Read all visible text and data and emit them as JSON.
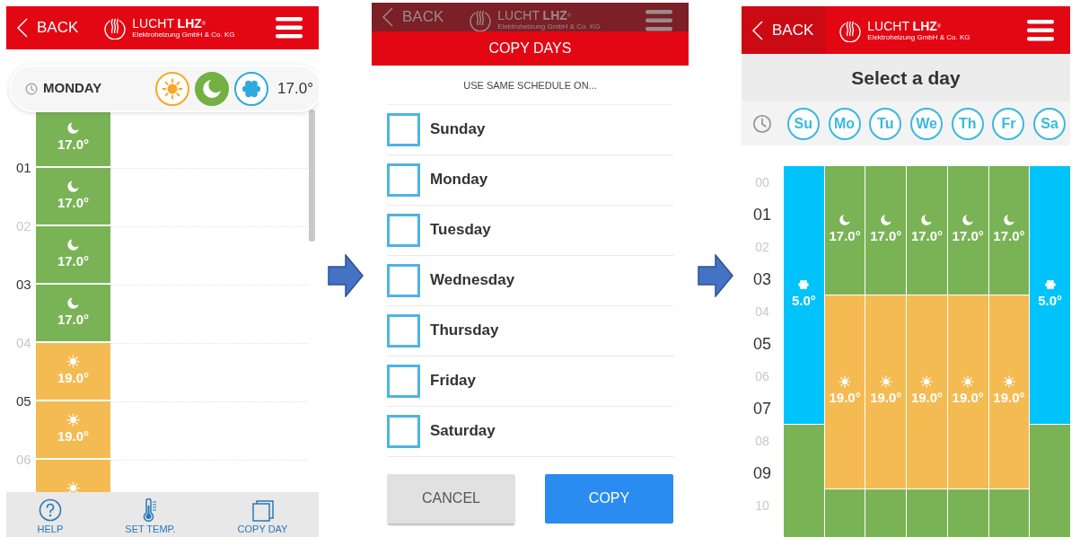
{
  "phones": [
    {
      "kind": "schedule",
      "header": {
        "back": "BACK",
        "brand": "LUCHT **LHZ**$^{®}$",
        "tagline": "Elektroheizung GmbH & Co. KG",
        "dimmed": false,
        "back_pressed": false
      },
      "day_bar": {
        "day": "MONDAY",
        "modes": [
          {
            "kind": "day",
            "selected": false
          },
          {
            "kind": "night",
            "selected": true
          },
          {
            "kind": "frost",
            "selected": false
          }
        ],
        "temperature": "17.0°"
      },
      "rows": [
        {
          "kind": "night",
          "temp": "17.0°"
        },
        {
          "hour": "01",
          "major": true,
          "kind": "night",
          "temp": "17.0°"
        },
        {
          "hour": "02",
          "major": false,
          "kind": "night",
          "temp": "17.0°"
        },
        {
          "hour": "03",
          "major": true,
          "kind": "night",
          "temp": "17.0°"
        },
        {
          "hour": "04",
          "major": false,
          "kind": "day",
          "temp": "19.0°"
        },
        {
          "hour": "05",
          "major": true,
          "kind": "day",
          "temp": "19.0°"
        },
        {
          "hour": "06",
          "major": false,
          "kind": "day"
        }
      ],
      "toolbar": [
        {
          "kind": "help",
          "label": "HELP"
        },
        {
          "kind": "thermometer",
          "label": "SET TEMP."
        },
        {
          "kind": "copy",
          "label": "COPY DAY"
        }
      ]
    },
    {
      "kind": "copy_days",
      "header": {
        "back": "BACK",
        "brand": "LUCHT **LHZ**$^{®}$",
        "tagline": "Elektroheizung GmbH & Co. KG",
        "dimmed": true,
        "back_pressed": false
      },
      "title": "COPY DAYS",
      "prompt": "USE SAME SCHEDULE ON...",
      "days": [
        {
          "label": "Sunday",
          "checked": false
        },
        {
          "label": "Monday",
          "checked": false
        },
        {
          "label": "Tuesday",
          "checked": false
        },
        {
          "label": "Wednesday",
          "checked": false
        },
        {
          "label": "Thursday",
          "checked": false
        },
        {
          "label": "Friday",
          "checked": false
        },
        {
          "label": "Saturday",
          "checked": false
        }
      ],
      "buttons": [
        {
          "kind": "cancel",
          "label": "CANCEL"
        },
        {
          "kind": "primary",
          "label": "COPY"
        }
      ]
    },
    {
      "kind": "week",
      "header": {
        "back": "BACK",
        "brand": "LUCHT **LHZ**$^{®}$",
        "tagline": "Elektroheizung GmbH & Co. KG",
        "dimmed": false,
        "back_pressed": true
      },
      "title": "Select a day",
      "hours": [
        {
          "label": "00",
          "major": false
        },
        {
          "label": "01",
          "major": true
        },
        {
          "label": "02",
          "major": false
        },
        {
          "label": "03",
          "major": true
        },
        {
          "label": "04",
          "major": false
        },
        {
          "label": "05",
          "major": true
        },
        {
          "label": "06",
          "major": false
        },
        {
          "label": "07",
          "major": true
        },
        {
          "label": "08",
          "major": false
        },
        {
          "label": "09",
          "major": true
        },
        {
          "label": "10",
          "major": false
        }
      ],
      "days": [
        {
          "label": "Su",
          "slots": [
            {
              "kind": "frost",
              "temp": "5.0°"
            },
            {
              "kind": "frost"
            },
            {
              "kind": "frost"
            },
            {
              "kind": "frost"
            },
            {
              "kind": "frost"
            },
            {
              "kind": "frost"
            },
            {
              "kind": "frost"
            },
            {
              "kind": "frost"
            },
            {
              "kind": "night"
            },
            {
              "kind": "night"
            },
            {
              "kind": "night"
            },
            {
              "kind": "night"
            }
          ]
        },
        {
          "label": "Mo",
          "slots": [
            {
              "kind": "night",
              "temp": "17.0°"
            },
            {
              "kind": "night"
            },
            {
              "kind": "night"
            },
            {
              "kind": "night"
            },
            {
              "kind": "day",
              "temp": "19.0°"
            },
            {
              "kind": "day"
            },
            {
              "kind": "day"
            },
            {
              "kind": "day"
            },
            {
              "kind": "day"
            },
            {
              "kind": "day"
            },
            {
              "kind": "night"
            },
            {
              "kind": "night"
            }
          ]
        },
        {
          "label": "Tu",
          "slots": [
            {
              "kind": "night",
              "temp": "17.0°"
            },
            {
              "kind": "night"
            },
            {
              "kind": "night"
            },
            {
              "kind": "night"
            },
            {
              "kind": "day",
              "temp": "19.0°"
            },
            {
              "kind": "day"
            },
            {
              "kind": "day"
            },
            {
              "kind": "day"
            },
            {
              "kind": "day"
            },
            {
              "kind": "day"
            },
            {
              "kind": "night"
            },
            {
              "kind": "night"
            }
          ]
        },
        {
          "label": "We",
          "slots": [
            {
              "kind": "night",
              "temp": "17.0°"
            },
            {
              "kind": "night"
            },
            {
              "kind": "night"
            },
            {
              "kind": "night"
            },
            {
              "kind": "day",
              "temp": "19.0°"
            },
            {
              "kind": "day"
            },
            {
              "kind": "day"
            },
            {
              "kind": "day"
            },
            {
              "kind": "day"
            },
            {
              "kind": "day"
            },
            {
              "kind": "night"
            },
            {
              "kind": "night"
            }
          ]
        },
        {
          "label": "Th",
          "slots": [
            {
              "kind": "night",
              "temp": "17.0°"
            },
            {
              "kind": "night"
            },
            {
              "kind": "night"
            },
            {
              "kind": "night"
            },
            {
              "kind": "day",
              "temp": "19.0°"
            },
            {
              "kind": "day"
            },
            {
              "kind": "day"
            },
            {
              "kind": "day"
            },
            {
              "kind": "day"
            },
            {
              "kind": "day"
            },
            {
              "kind": "night"
            },
            {
              "kind": "night"
            }
          ]
        },
        {
          "label": "Fr",
          "slots": [
            {
              "kind": "night",
              "temp": "17.0°"
            },
            {
              "kind": "night"
            },
            {
              "kind": "night"
            },
            {
              "kind": "night"
            },
            {
              "kind": "day",
              "temp": "19.0°"
            },
            {
              "kind": "day"
            },
            {
              "kind": "day"
            },
            {
              "kind": "day"
            },
            {
              "kind": "day"
            },
            {
              "kind": "day"
            },
            {
              "kind": "night"
            },
            {
              "kind": "night"
            }
          ]
        },
        {
          "label": "Sa",
          "slots": [
            {
              "kind": "frost",
              "temp": "5.0°"
            },
            {
              "kind": "frost"
            },
            {
              "kind": "frost"
            },
            {
              "kind": "frost"
            },
            {
              "kind": "frost"
            },
            {
              "kind": "frost"
            },
            {
              "kind": "frost"
            },
            {
              "kind": "frost"
            },
            {
              "kind": "night"
            },
            {
              "kind": "night"
            },
            {
              "kind": "night"
            },
            {
              "kind": "night"
            }
          ]
        }
      ]
    }
  ]
}
